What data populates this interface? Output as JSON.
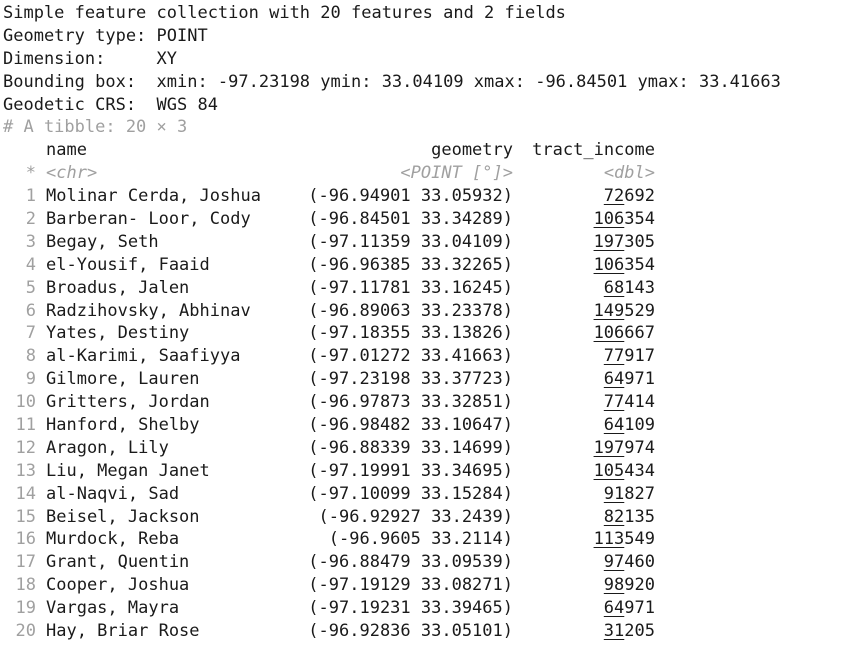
{
  "meta": {
    "line1": "Simple feature collection with 20 features and 2 fields",
    "line2": "Geometry type: POINT",
    "line3": "Dimension:     XY",
    "line4": "Bounding box:  xmin: -97.23198 ymin: 33.04109 xmax: -96.84501 ymax: 33.41663",
    "line5": "Geodetic CRS:  WGS 84",
    "tibble": "# A tibble: 20 × 3"
  },
  "columns": {
    "name": "name",
    "geometry": "geometry",
    "income": "tract_income",
    "star": "*",
    "name_type": "<chr>",
    "geometry_type": "<POINT [°]>",
    "income_type": "<dbl>"
  },
  "rows": [
    {
      "idx": "1",
      "name": "Molinar Cerda, Joshua",
      "geometry": "(-96.94901 33.05932)",
      "income_hi": "",
      "income_ul": "72",
      "income_lo": "692"
    },
    {
      "idx": "2",
      "name": "Barberan- Loor, Cody",
      "geometry": "(-96.84501 33.34289)",
      "income_hi": "",
      "income_ul": "106",
      "income_lo": "354"
    },
    {
      "idx": "3",
      "name": "Begay, Seth",
      "geometry": "(-97.11359 33.04109)",
      "income_hi": "",
      "income_ul": "197",
      "income_lo": "305"
    },
    {
      "idx": "4",
      "name": "el-Yousif, Faaid",
      "geometry": "(-96.96385 33.32265)",
      "income_hi": "",
      "income_ul": "106",
      "income_lo": "354"
    },
    {
      "idx": "5",
      "name": "Broadus, Jalen",
      "geometry": "(-97.11781 33.16245)",
      "income_hi": "",
      "income_ul": "68",
      "income_lo": "143"
    },
    {
      "idx": "6",
      "name": "Radzihovsky, Abhinav",
      "geometry": "(-96.89063 33.23378)",
      "income_hi": "",
      "income_ul": "149",
      "income_lo": "529"
    },
    {
      "idx": "7",
      "name": "Yates, Destiny",
      "geometry": "(-97.18355 33.13826)",
      "income_hi": "",
      "income_ul": "106",
      "income_lo": "667"
    },
    {
      "idx": "8",
      "name": "al-Karimi, Saafiyya",
      "geometry": "(-97.01272 33.41663)",
      "income_hi": "",
      "income_ul": "77",
      "income_lo": "917"
    },
    {
      "idx": "9",
      "name": "Gilmore, Lauren",
      "geometry": "(-97.23198 33.37723)",
      "income_hi": "",
      "income_ul": "64",
      "income_lo": "971"
    },
    {
      "idx": "10",
      "name": "Gritters, Jordan",
      "geometry": "(-96.97873 33.32851)",
      "income_hi": "",
      "income_ul": "77",
      "income_lo": "414"
    },
    {
      "idx": "11",
      "name": "Hanford, Shelby",
      "geometry": "(-96.98482 33.10647)",
      "income_hi": "",
      "income_ul": "64",
      "income_lo": "109"
    },
    {
      "idx": "12",
      "name": "Aragon, Lily",
      "geometry": "(-96.88339 33.14699)",
      "income_hi": "",
      "income_ul": "197",
      "income_lo": "974"
    },
    {
      "idx": "13",
      "name": "Liu, Megan Janet",
      "geometry": "(-97.19991 33.34695)",
      "income_hi": "",
      "income_ul": "105",
      "income_lo": "434"
    },
    {
      "idx": "14",
      "name": "al-Naqvi, Sad",
      "geometry": "(-97.10099 33.15284)",
      "income_hi": "",
      "income_ul": "91",
      "income_lo": "827"
    },
    {
      "idx": "15",
      "name": "Beisel, Jackson",
      "geometry": "(-96.92927 33.2439)",
      "income_hi": "",
      "income_ul": "82",
      "income_lo": "135"
    },
    {
      "idx": "16",
      "name": "Murdock, Reba",
      "geometry": "(-96.9605 33.2114)",
      "income_hi": "",
      "income_ul": "113",
      "income_lo": "549"
    },
    {
      "idx": "17",
      "name": "Grant, Quentin",
      "geometry": "(-96.88479 33.09539)",
      "income_hi": "",
      "income_ul": "97",
      "income_lo": "460"
    },
    {
      "idx": "18",
      "name": "Cooper, Joshua",
      "geometry": "(-97.19129 33.08271)",
      "income_hi": "",
      "income_ul": "98",
      "income_lo": "920"
    },
    {
      "idx": "19",
      "name": "Vargas, Mayra",
      "geometry": "(-97.19231 33.39465)",
      "income_hi": "",
      "income_ul": "64",
      "income_lo": "971"
    },
    {
      "idx": "20",
      "name": "Hay, Briar Rose",
      "geometry": "(-96.92836 33.05101)",
      "income_hi": "",
      "income_ul": "31",
      "income_lo": "205"
    }
  ]
}
